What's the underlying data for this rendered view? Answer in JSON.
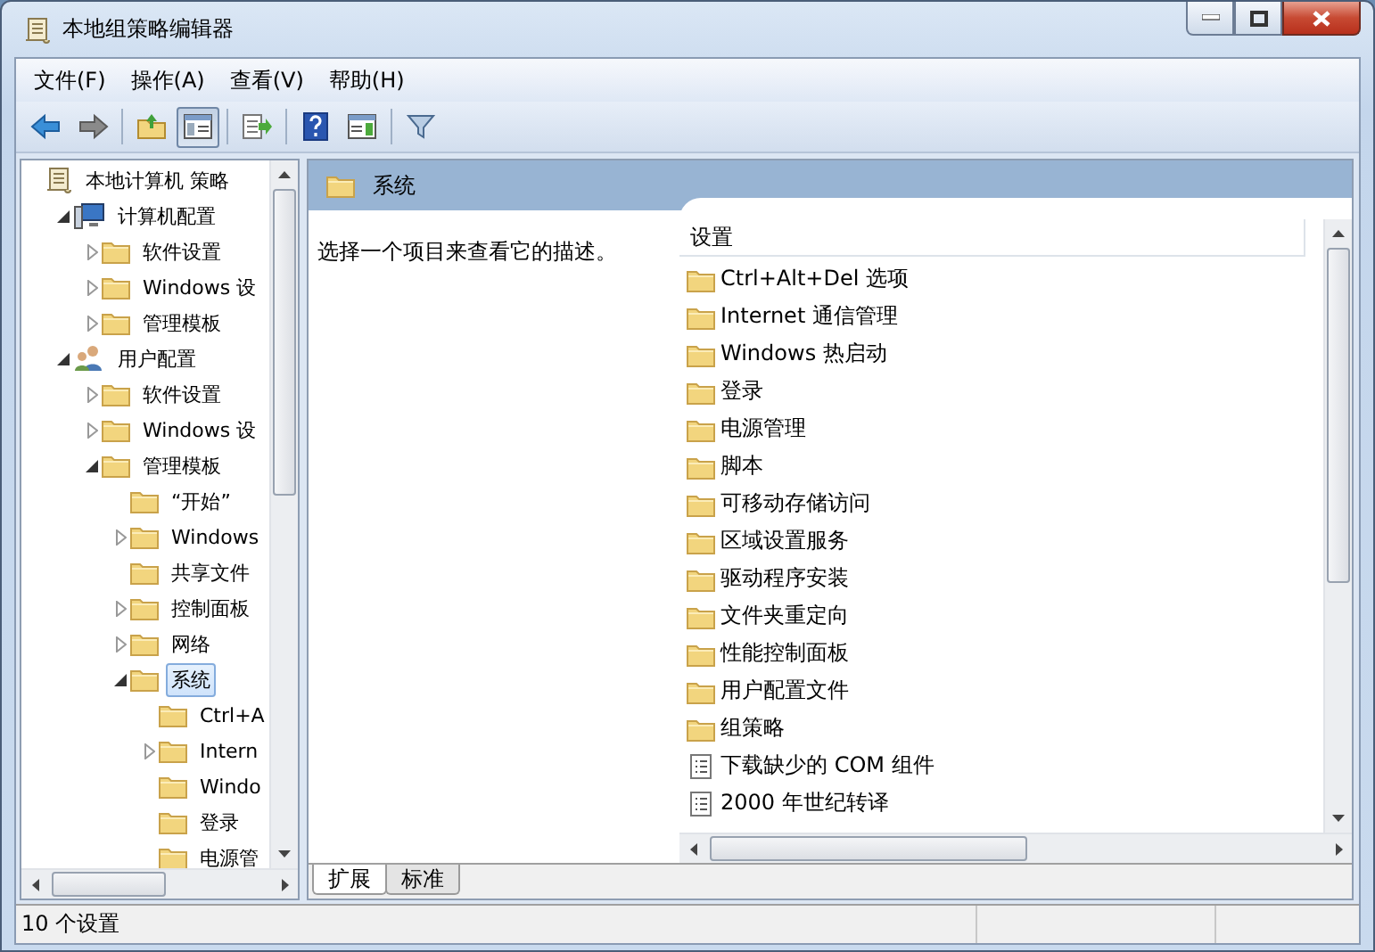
{
  "window": {
    "title": "本地组策略编辑器"
  },
  "menu": [
    {
      "label": "文件(F)"
    },
    {
      "label": "操作(A)"
    },
    {
      "label": "查看(V)"
    },
    {
      "label": "帮助(H)"
    }
  ],
  "toolbar": {
    "groups": [
      {
        "buttons": [
          {
            "kind": "back",
            "pressed": false
          },
          {
            "kind": "forward",
            "pressed": false
          }
        ]
      },
      {
        "buttons": [
          {
            "kind": "up",
            "pressed": false
          },
          {
            "kind": "tree",
            "pressed": true
          }
        ]
      },
      {
        "buttons": [
          {
            "kind": "export",
            "pressed": false
          }
        ]
      },
      {
        "buttons": [
          {
            "kind": "help",
            "pressed": false
          },
          {
            "kind": "action",
            "pressed": false
          }
        ]
      },
      {
        "buttons": [
          {
            "kind": "filter",
            "pressed": false
          }
        ]
      }
    ]
  },
  "tree": [
    {
      "label": "本地计算机 策略",
      "kind": "policy",
      "expandable": false,
      "selected": false,
      "children": [
        {
          "label": "计算机配置",
          "kind": "computer",
          "expandable": true,
          "expanded": true,
          "selected": false,
          "children": [
            {
              "label": "软件设置",
              "kind": "folder",
              "expandable": true,
              "expanded": false,
              "selected": false
            },
            {
              "label": "Windows 设",
              "kind": "folder",
              "expandable": true,
              "expanded": false,
              "selected": false
            },
            {
              "label": "管理模板",
              "kind": "folder",
              "expandable": true,
              "expanded": false,
              "selected": false
            }
          ]
        },
        {
          "label": "用户配置",
          "kind": "user",
          "expandable": true,
          "expanded": true,
          "selected": false,
          "children": [
            {
              "label": "软件设置",
              "kind": "folder",
              "expandable": true,
              "expanded": false,
              "selected": false
            },
            {
              "label": "Windows 设",
              "kind": "folder",
              "expandable": true,
              "expanded": false,
              "selected": false
            },
            {
              "label": "管理模板",
              "kind": "folder",
              "expandable": true,
              "expanded": true,
              "selected": false,
              "children": [
                {
                  "label": "“开始”",
                  "kind": "folder",
                  "expandable": false,
                  "selected": false
                },
                {
                  "label": "Windows",
                  "kind": "folder",
                  "expandable": true,
                  "expanded": false,
                  "selected": false
                },
                {
                  "label": "共享文件",
                  "kind": "folder",
                  "expandable": false,
                  "selected": false
                },
                {
                  "label": "控制面板",
                  "kind": "folder",
                  "expandable": true,
                  "expanded": false,
                  "selected": false
                },
                {
                  "label": "网络",
                  "kind": "folder",
                  "expandable": true,
                  "expanded": false,
                  "selected": false
                },
                {
                  "label": "系统",
                  "kind": "folder",
                  "expandable": true,
                  "expanded": true,
                  "selected": true,
                  "children": [
                    {
                      "label": "Ctrl+A",
                      "kind": "folder",
                      "expandable": false,
                      "selected": false
                    },
                    {
                      "label": "Intern",
                      "kind": "folder",
                      "expandable": true,
                      "expanded": false,
                      "selected": false
                    },
                    {
                      "label": "Windo",
                      "kind": "folder",
                      "expandable": false,
                      "selected": false
                    },
                    {
                      "label": "登录",
                      "kind": "folder",
                      "expandable": false,
                      "selected": false
                    },
                    {
                      "label": "电源管",
                      "kind": "folder",
                      "expandable": false,
                      "selected": false
                    }
                  ]
                }
              ]
            }
          ]
        }
      ]
    }
  ],
  "detail": {
    "title": "系统",
    "description": "选择一个项目来查看它的描述。",
    "column": "设置",
    "items": [
      {
        "label": "Ctrl+Alt+Del 选项",
        "kind": "folder"
      },
      {
        "label": "Internet 通信管理",
        "kind": "folder"
      },
      {
        "label": "Windows 热启动",
        "kind": "folder"
      },
      {
        "label": "登录",
        "kind": "folder"
      },
      {
        "label": "电源管理",
        "kind": "folder"
      },
      {
        "label": "脚本",
        "kind": "folder"
      },
      {
        "label": "可移动存储访问",
        "kind": "folder"
      },
      {
        "label": "区域设置服务",
        "kind": "folder"
      },
      {
        "label": "驱动程序安装",
        "kind": "folder"
      },
      {
        "label": "文件夹重定向",
        "kind": "folder"
      },
      {
        "label": "性能控制面板",
        "kind": "folder"
      },
      {
        "label": "用户配置文件",
        "kind": "folder"
      },
      {
        "label": "组策略",
        "kind": "folder"
      },
      {
        "label": "下载缺少的 COM 组件",
        "kind": "setting"
      },
      {
        "label": "2000 年世纪转译",
        "kind": "setting"
      }
    ],
    "tabs": [
      {
        "label": "扩展",
        "selected": true
      },
      {
        "label": "标准",
        "selected": false
      }
    ]
  },
  "status_bar": {
    "text": "10 个设置"
  }
}
